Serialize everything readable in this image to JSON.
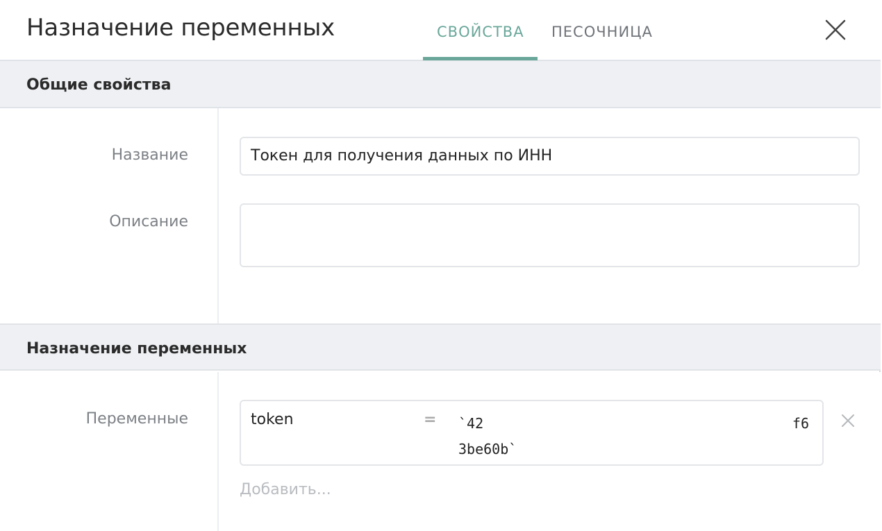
{
  "header": {
    "title": "Назначение переменных",
    "tabs": [
      {
        "label": "СВОЙСТВА",
        "active": true
      },
      {
        "label": "ПЕСОЧНИЦА",
        "active": false
      }
    ],
    "close_icon": "close-icon"
  },
  "general": {
    "section_title": "Общие свойства",
    "name_label": "Название",
    "name_value": "Токен для получения данных по ИНН",
    "description_label": "Описание",
    "description_value": ""
  },
  "assignment": {
    "section_title": "Назначение переменных",
    "variables_label": "Переменные",
    "variables": [
      {
        "name": "token",
        "operator": "=",
        "value_line1_left": "`42",
        "value_line1_right": "f6",
        "value_line2": "3be60b`"
      }
    ],
    "add_label": "Добавить..."
  },
  "colors": {
    "accent": "#6aa79a",
    "section_bg": "#eef0f3",
    "muted_text": "#7c8085"
  }
}
